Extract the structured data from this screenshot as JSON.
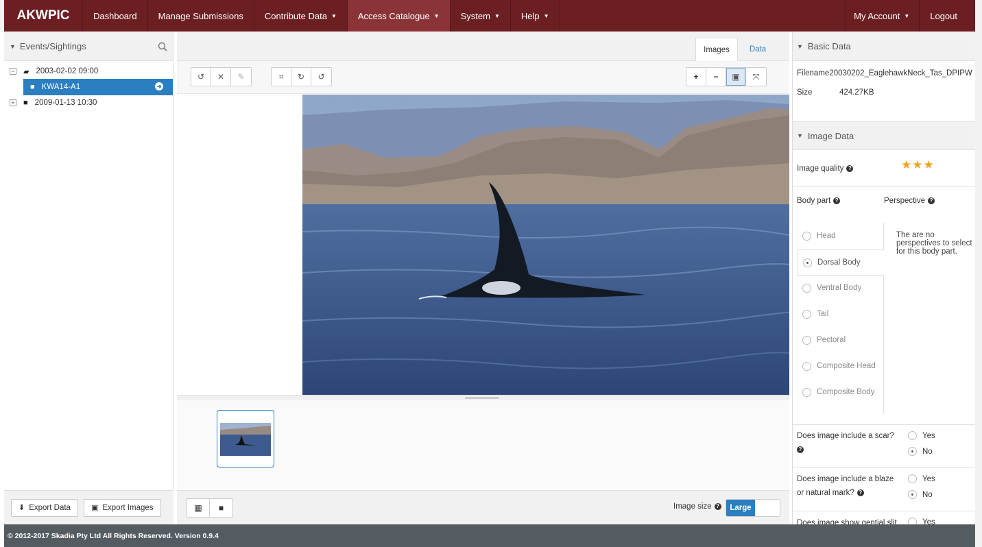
{
  "nav": {
    "brand": "AKWPIC",
    "items": [
      {
        "label": "Dashboard",
        "caret": false
      },
      {
        "label": "Manage Submissions",
        "caret": false
      },
      {
        "label": "Contribute Data",
        "caret": true
      },
      {
        "label": "Access Catalogue",
        "caret": true,
        "active": true
      },
      {
        "label": "System",
        "caret": true
      },
      {
        "label": "Help",
        "caret": true
      }
    ],
    "account": "My Account",
    "logout": "Logout",
    "brand_color": "#6b1f22"
  },
  "left": {
    "title": "Events/Sightings",
    "tree": [
      {
        "label": "2003-02-02 09:00",
        "expanded": true
      },
      {
        "label": "KWA14-A1",
        "selected": true
      },
      {
        "label": "2009-01-13 10:30",
        "expanded": false
      }
    ],
    "export_data": "Export Data",
    "export_images": "Export Images"
  },
  "center": {
    "tab_images": "Images",
    "tab_data": "Data",
    "image_size_label": "Image size",
    "image_size_value": "Large"
  },
  "right": {
    "basic_title": "Basic Data",
    "filename_label": "Filename",
    "filename_value": "20030202_EaglehawkNeck_Tas_DPIPW",
    "size_label": "Size",
    "size_value": "424.27KB",
    "image_title": "Image Data",
    "quality_label": "Image quality",
    "quality_stars": 3,
    "bodypart_label": "Body part",
    "perspective_label": "Perspective",
    "body_parts": [
      "Head",
      "Dorsal Body",
      "Ventral Body",
      "Tail",
      "Pectoral",
      "Composite Head",
      "Composite Body"
    ],
    "selected_body_part": "Dorsal Body",
    "perspective_msg": "The are no perspectives to select for this body part.",
    "q_scar": "Does image include a scar?",
    "q_blaze": "Does image include a blaze or natural mark?",
    "q_genital": "Does image show gential slit",
    "yes": "Yes",
    "no": "No"
  },
  "footer": "© 2012-2017 Skadia Pty Ltd All Rights Reserved. Version 0.9.4"
}
